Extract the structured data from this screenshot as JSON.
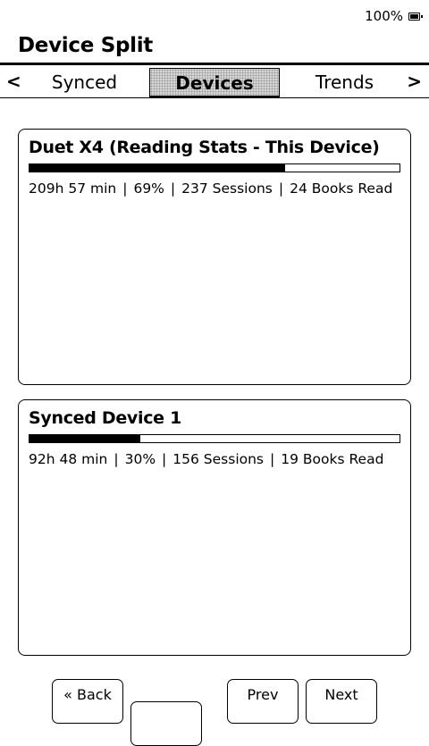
{
  "status": {
    "battery_text": "100%",
    "battery_level": 1.0,
    "battery_icon": "battery-charging-icon"
  },
  "header": {
    "title": "Device Split"
  },
  "tabs": {
    "prev_arrow": "<",
    "next_arrow": ">",
    "items": [
      {
        "label": "Synced",
        "active": false
      },
      {
        "label": "Devices",
        "active": true
      },
      {
        "label": "Trends",
        "active": false
      }
    ]
  },
  "devices": [
    {
      "name": "Duet X4 (Reading Stats - This Device)",
      "share": 0.69,
      "time": "209h 57 min",
      "percent": "69%",
      "sessions": "237 Sessions",
      "books": "24 Books Read"
    },
    {
      "name": "Synced Device 1",
      "share": 0.3,
      "time": "92h 48 min",
      "percent": "30%",
      "sessions": "156 Sessions",
      "books": "19 Books Read"
    }
  ],
  "separator": "|",
  "footer": {
    "back_label": "« Back",
    "center_label": "",
    "prev_label": "Prev",
    "next_label": "Next"
  }
}
